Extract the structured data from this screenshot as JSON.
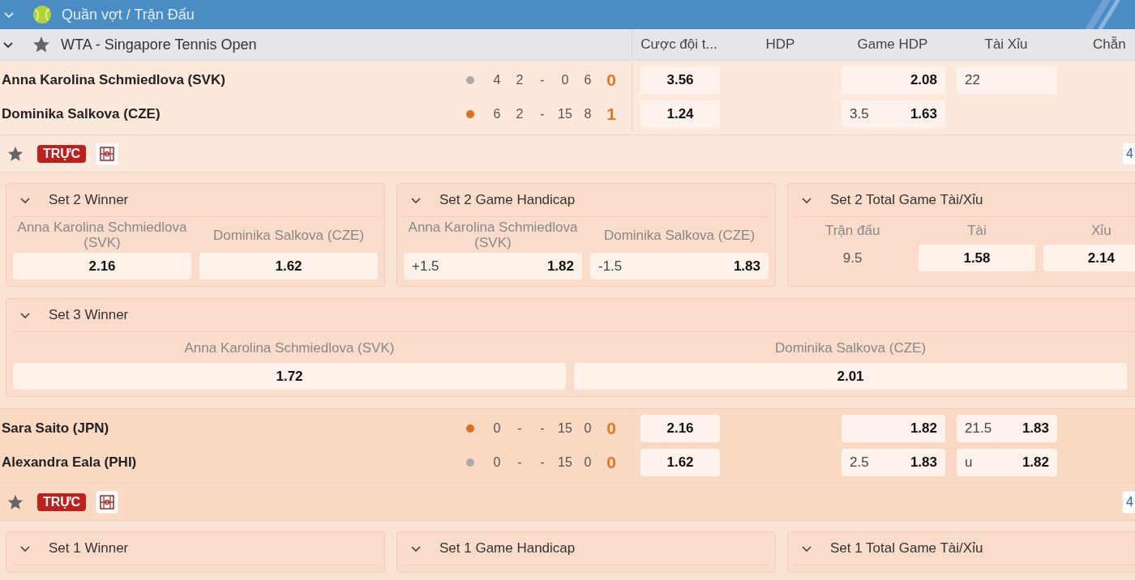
{
  "sport_bar": {
    "title": "Quần vợt / Trận Đấu"
  },
  "league": {
    "name": "WTA - Singapore Tennis Open",
    "columns": [
      "Cược đội t...",
      "HDP",
      "Game HDP",
      "Tài Xỉu",
      "Chẵn"
    ]
  },
  "matches": [
    {
      "players": [
        {
          "name": "Anna Karolina Schmiedlova (SVK)",
          "serving": false,
          "scores": [
            "4",
            "2",
            "-",
            "0",
            "6"
          ],
          "sets": "0",
          "moneyline": "3.56",
          "game_hdp": {
            "odds": "2.08"
          },
          "total": {
            "line": "22"
          }
        },
        {
          "name": "Dominika Salkova (CZE)",
          "serving": true,
          "scores": [
            "6",
            "2",
            "-",
            "15",
            "8"
          ],
          "sets": "1",
          "moneyline": "1.24",
          "game_hdp": {
            "line": "3.5",
            "odds": "1.63"
          }
        }
      ],
      "live_label": "TRỰC",
      "more_count": "4",
      "market_rows": [
        [
          {
            "kind": "two_way",
            "title": "Set 2 Winner",
            "selections": [
              {
                "label": "Anna Karolina Schmiedlova (SVK)",
                "odds": "2.16"
              },
              {
                "label": "Dominika Salkova (CZE)",
                "odds": "1.62"
              }
            ]
          },
          {
            "kind": "two_way",
            "title": "Set 2 Game Handicap",
            "selections": [
              {
                "label": "Anna Karolina Schmiedlova (SVK)",
                "line": "+1.5",
                "odds": "1.82"
              },
              {
                "label": "Dominika Salkova (CZE)",
                "line": "-1.5",
                "odds": "1.83"
              }
            ]
          },
          {
            "kind": "total",
            "title": "Set 2 Total Game Tài/Xỉu",
            "headers": [
              "Trận đấu",
              "Tài",
              "Xỉu"
            ],
            "line": "9.5",
            "odds": [
              "1.58",
              "2.14"
            ]
          }
        ],
        [
          {
            "kind": "two_way",
            "title": "Set 3 Winner",
            "selections": [
              {
                "label": "Anna Karolina Schmiedlova (SVK)",
                "odds": "1.72"
              },
              {
                "label": "Dominika Salkova (CZE)",
                "odds": "2.01"
              }
            ]
          }
        ]
      ]
    },
    {
      "players": [
        {
          "name": "Sara Saito (JPN)",
          "serving": true,
          "scores": [
            "0",
            "-",
            "-",
            "15",
            "0"
          ],
          "sets": "0",
          "moneyline": "2.16",
          "game_hdp": {
            "odds": "1.82"
          },
          "total": {
            "line": "21.5",
            "odds": "1.83"
          }
        },
        {
          "name": "Alexandra Eala (PHI)",
          "serving": false,
          "scores": [
            "0",
            "-",
            "-",
            "15",
            "0"
          ],
          "sets": "0",
          "moneyline": "1.62",
          "game_hdp": {
            "line": "2.5",
            "odds": "1.83"
          },
          "total": {
            "line": "u",
            "odds": "1.82"
          }
        }
      ],
      "live_label": "TRỰC",
      "more_count": "4",
      "market_rows": [
        [
          {
            "kind": "two_way",
            "title": "Set 1 Winner"
          },
          {
            "kind": "two_way",
            "title": "Set 1 Game Handicap"
          },
          {
            "kind": "total",
            "title": "Set 1 Total Game Tài/Xỉu"
          }
        ]
      ]
    }
  ]
}
